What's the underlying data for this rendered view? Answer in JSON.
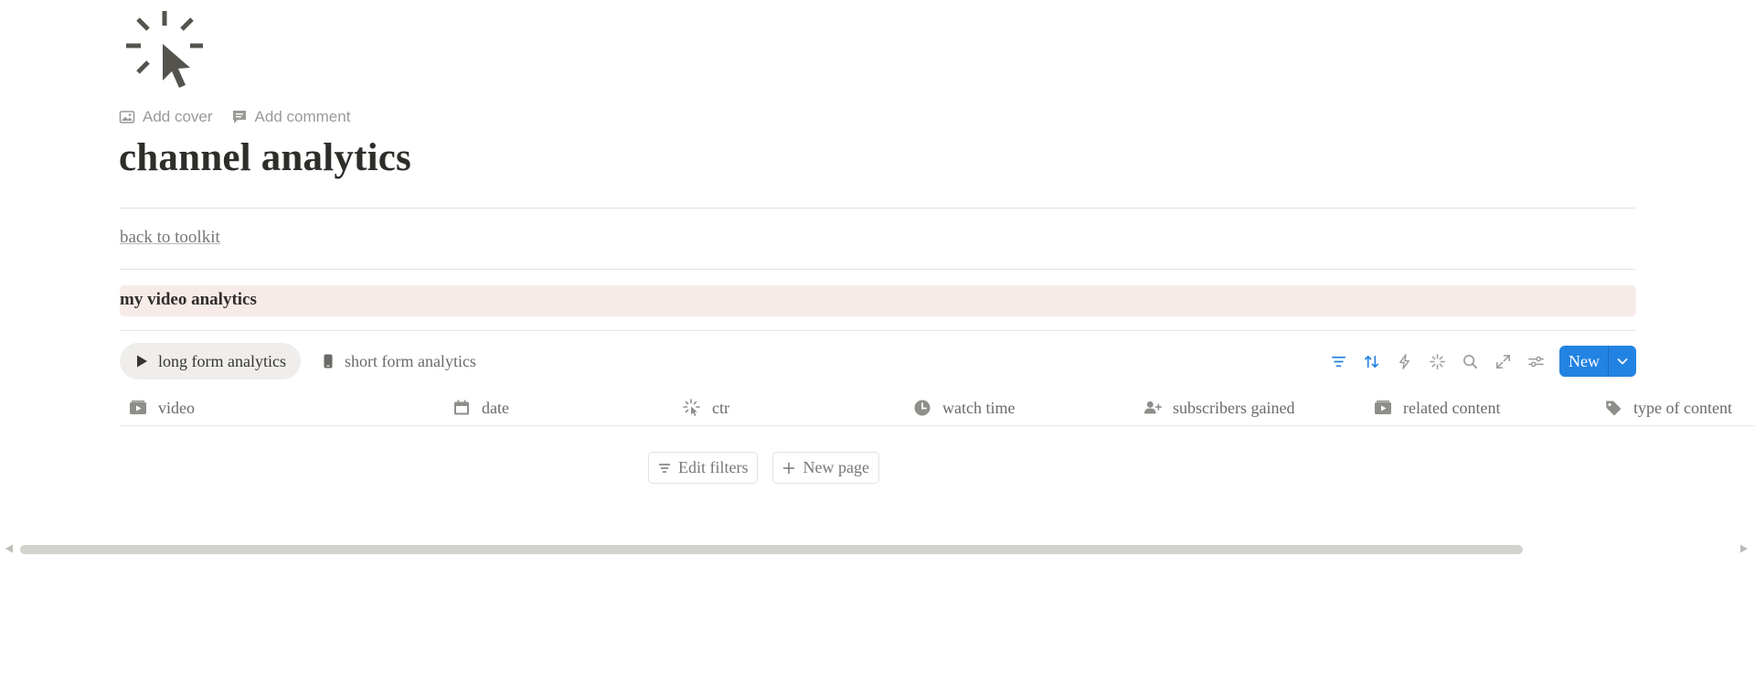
{
  "page": {
    "icon": "cursor-click-icon",
    "actions": {
      "add_cover": "Add cover",
      "add_comment": "Add comment"
    },
    "title": "channel analytics",
    "back_link": "back to toolkit",
    "callout": "my video analytics"
  },
  "views": {
    "tabs": [
      {
        "label": "long form analytics",
        "icon": "play-icon",
        "active": true
      },
      {
        "label": "short form analytics",
        "icon": "phone-icon",
        "active": false
      }
    ],
    "toolbar": {
      "icons": [
        "filter-icon",
        "sort-icon",
        "lightning-icon",
        "sparkle-icon",
        "search-icon",
        "expand-icon",
        "settings-sliders-icon"
      ],
      "new_label": "New",
      "accent": "#2383e2"
    }
  },
  "table": {
    "columns": [
      {
        "label": "video",
        "icon": "video-icon"
      },
      {
        "label": "date",
        "icon": "calendar-icon"
      },
      {
        "label": "ctr",
        "icon": "cursor-click-icon"
      },
      {
        "label": "watch time",
        "icon": "clock-icon"
      },
      {
        "label": "subscribers gained",
        "icon": "add-person-icon"
      },
      {
        "label": "related content",
        "icon": "video-icon"
      },
      {
        "label": "type of content",
        "icon": "tag-icon"
      }
    ],
    "empty_actions": {
      "edit_filters": "Edit filters",
      "new_page": "New page"
    }
  },
  "colors": {
    "callout_bg": "#f6ebe9",
    "text": "#37352f",
    "muted": "#787774"
  }
}
